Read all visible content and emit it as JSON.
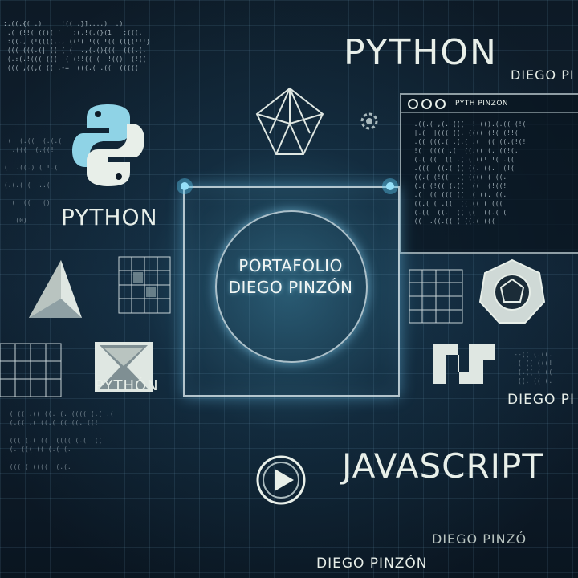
{
  "headings": {
    "python_top": "PYTHON",
    "python_left": "PYTHON",
    "python_small": "PYTHÓN",
    "javascript": "JAVASCRIPT"
  },
  "names": {
    "top_right": "DIEGO PI",
    "mid_right": "DIEGO PI",
    "bottom_right": "DIEGO PINZÓ",
    "bottom_center": "DIEGO PINZÓN"
  },
  "center": {
    "line1": "PORTAFOLIO",
    "line2": "DIEGO PINZÓN"
  },
  "code_window": {
    "title": "PYTH PINZON"
  },
  "icons": [
    "python-logo-icon",
    "crystal-icon",
    "triangle-icon",
    "hourglass-icon",
    "polygon-badge-icon",
    "play-icon",
    "n-logo-icon",
    "gear-icon"
  ],
  "colors": {
    "background": "#0b1622",
    "glow": "#5ac8f0",
    "python_logo": "#8fd3e6",
    "text": "#e8efe9"
  }
}
